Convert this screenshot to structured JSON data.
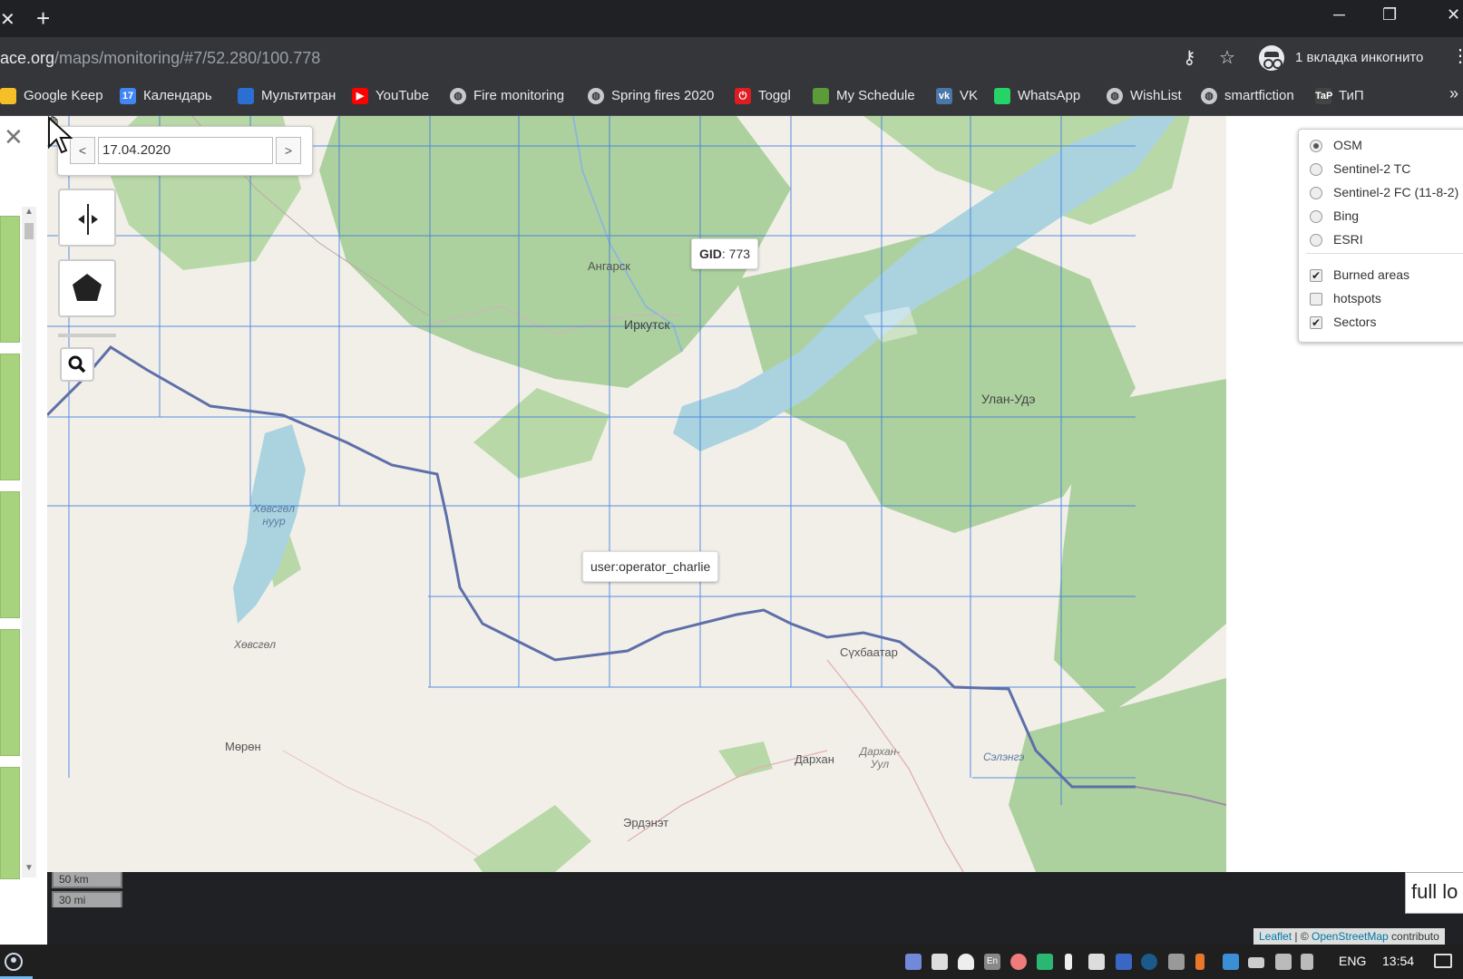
{
  "browser": {
    "url_host": "ace.org",
    "url_path": "/maps/monitoring/#7/52.280/100.778",
    "incognito_label": "1 вкладка инкогнито",
    "bookmarks": [
      {
        "label": "Google Keep",
        "icon": "keep-icon",
        "color": "#f6bf26"
      },
      {
        "label": "Календарь",
        "icon": "calendar-icon",
        "color": "#4285f4",
        "glyph": "17"
      },
      {
        "label": "Мультитран",
        "icon": "multitran-icon",
        "color": "#2a6fd1"
      },
      {
        "label": "YouTube",
        "icon": "youtube-icon",
        "color": "#ff0000",
        "glyph": "▶"
      },
      {
        "label": "Fire monitoring",
        "icon": "globe-icon"
      },
      {
        "label": "Spring fires 2020",
        "icon": "globe-icon"
      },
      {
        "label": "Toggl",
        "icon": "toggl-icon",
        "color": "#e01b22",
        "glyph": "⏻"
      },
      {
        "label": "My Schedule",
        "icon": "schedule-icon",
        "color": "#5c9b3a"
      },
      {
        "label": "VK",
        "icon": "vk-icon",
        "color": "#4a76a8",
        "glyph": "vk"
      },
      {
        "label": "WhatsApp",
        "icon": "whatsapp-icon",
        "color": "#25d366"
      },
      {
        "label": "WishList",
        "icon": "globe-icon"
      },
      {
        "label": "smartfiction",
        "icon": "globe-icon"
      },
      {
        "label": "ТиП",
        "icon": "tip-icon",
        "color": "#444",
        "glyph": "TaP"
      }
    ]
  },
  "map": {
    "date": "17.04.2020",
    "prev_label": "<",
    "next_label": ">",
    "gid_tooltip": {
      "key": "GID",
      "value": ": 773"
    },
    "user_tooltip": "user:operator_charlie",
    "places": {
      "angarsk": "Ангарск",
      "irkutsk": "Иркутск",
      "ulan_ude": "Улан-Удэ",
      "khovsgol_lake": "Хөвсгөл нуур",
      "khovsgol": "Хөвсгөл",
      "sukhbaatar": "Сүхбаатар",
      "moron": "Мөрөн",
      "darkhan": "Дархан",
      "darkhan_uul": "Дархан-Уул",
      "selenge": "Сэлэнгэ",
      "erdenet": "Эрдэнэт"
    },
    "colors": {
      "land": "#f2efe9",
      "forest": "#add19e",
      "water": "#aad3df",
      "grid": "#3a7be0",
      "border": "#5e6fa8"
    }
  },
  "layers": {
    "base": [
      {
        "label": "OSM",
        "checked": true
      },
      {
        "label": "Sentinel-2 TC",
        "checked": false
      },
      {
        "label": "Sentinel-2 FC (11-8-2)",
        "checked": false
      },
      {
        "label": "Bing",
        "checked": false
      },
      {
        "label": "ESRI",
        "checked": false
      }
    ],
    "overlays": [
      {
        "label": "Burned areas",
        "checked": true,
        "mark": "✔"
      },
      {
        "label": "hotspots",
        "checked": false,
        "mark": ""
      },
      {
        "label": "Sectors",
        "checked": true,
        "mark": "✔"
      }
    ]
  },
  "scale": {
    "km": "50 km",
    "mi": "30 mi"
  },
  "full_box": "full lo",
  "attribution": {
    "leaflet": "Leaflet",
    "sep": " | © ",
    "osm": "OpenStreetMap",
    "rest": " contributo"
  },
  "taskbar": {
    "lang": "ENG",
    "time": "13:54",
    "en_badge": "En"
  }
}
